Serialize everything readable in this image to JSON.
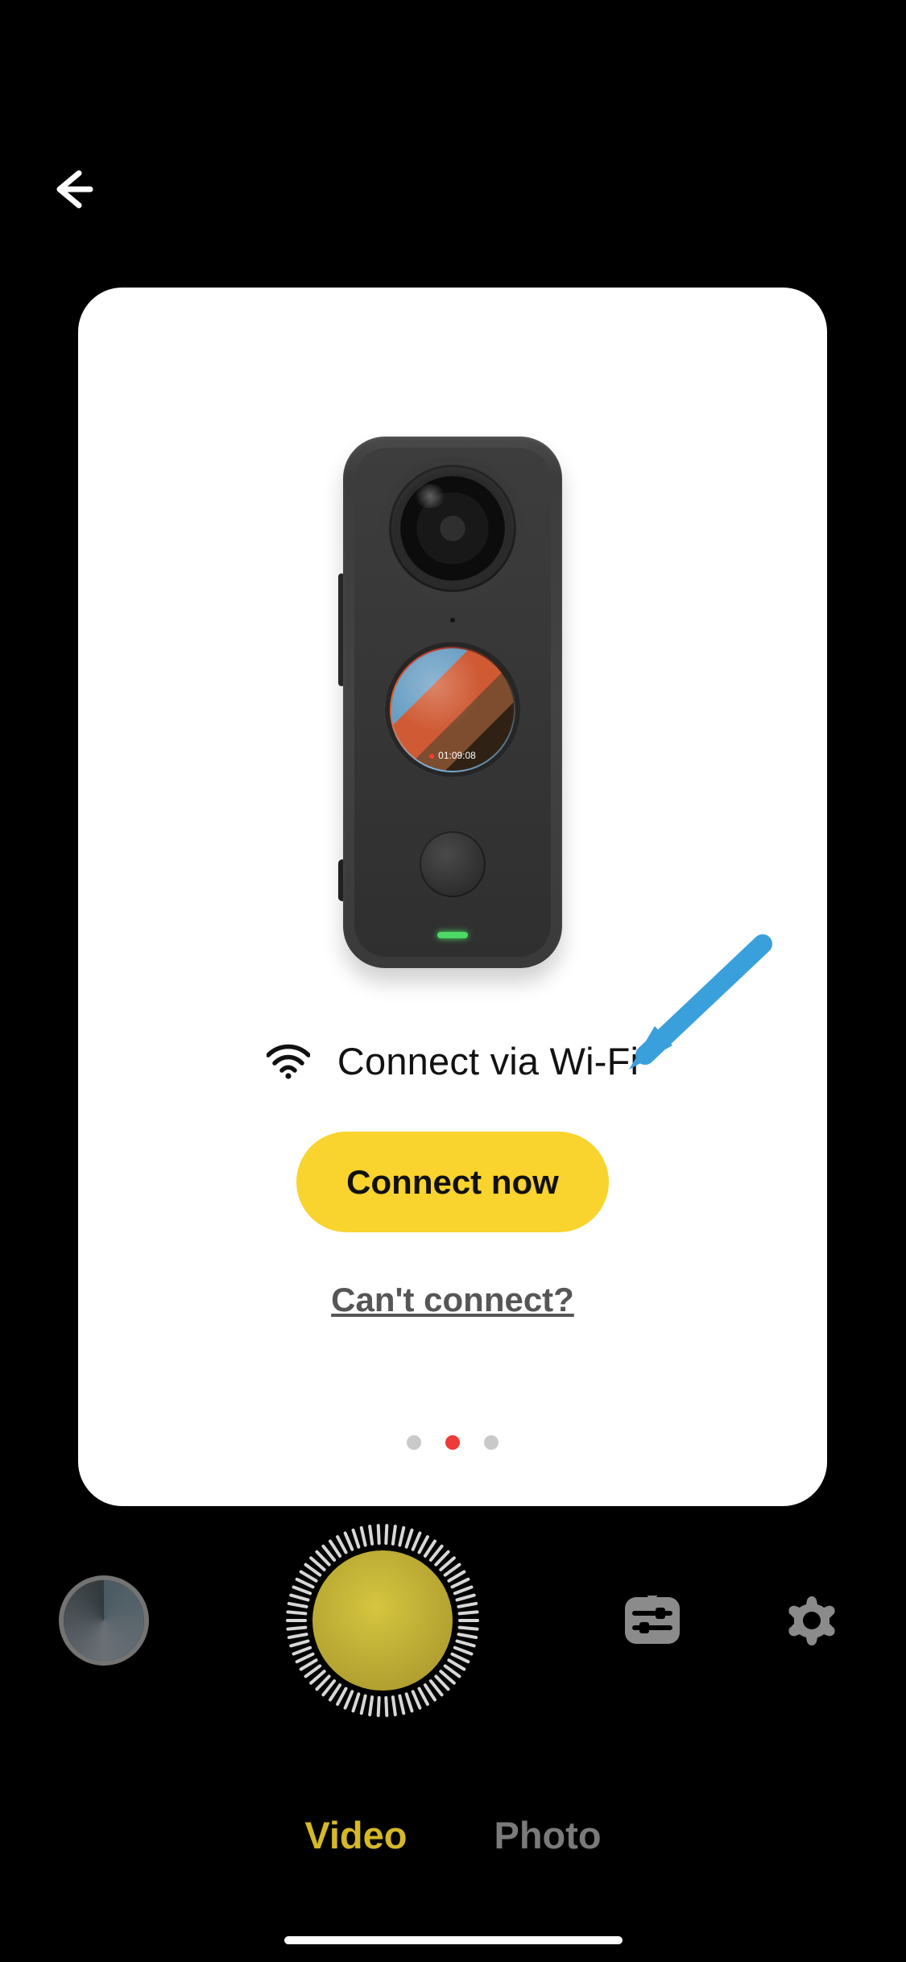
{
  "colors": {
    "accent": "#f9d32e",
    "arrow": "#39a0dc",
    "dot_active": "#ef3a3a",
    "record": "#c2b235"
  },
  "card": {
    "connect_label": "Connect via Wi-Fi",
    "primary_button": "Connect now",
    "help_link": "Can't connect?",
    "device_timestamp": "01:09:08",
    "page_index": 1,
    "page_count": 3
  },
  "icons": {
    "back": "back-arrow-icon",
    "wifi": "wifi-icon",
    "sliders": "sliders-icon",
    "gear": "gear-icon"
  },
  "bottom": {
    "mode_video": "Video",
    "mode_photo": "Photo",
    "active_mode": "Video"
  }
}
